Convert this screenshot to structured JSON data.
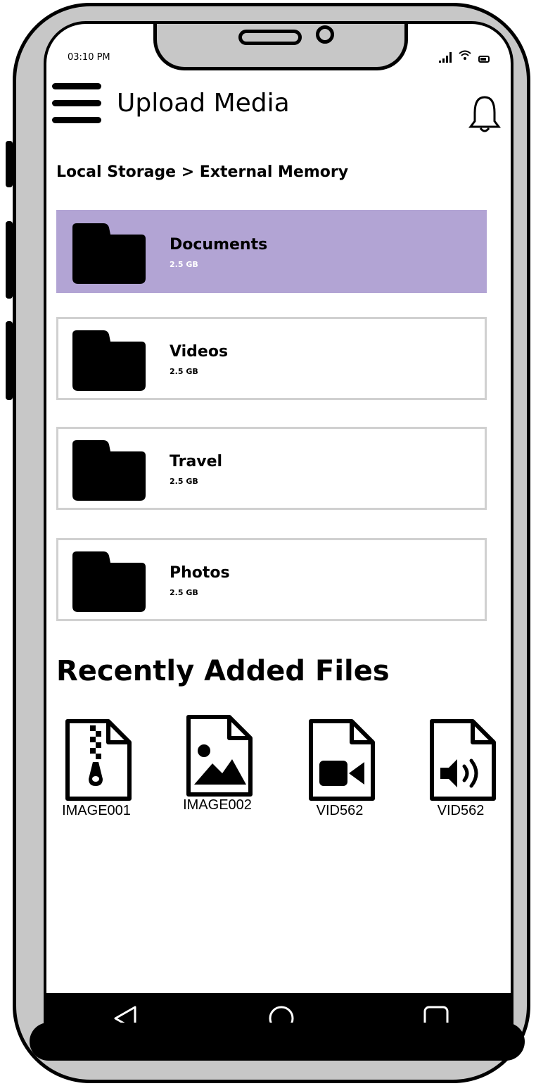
{
  "status_bar": {
    "time": "03:10 PM"
  },
  "header": {
    "title": "Upload Media"
  },
  "breadcrumb": "Local Storage > External Memory",
  "folders": [
    {
      "name": "Documents",
      "size": "2.5 GB",
      "selected": true
    },
    {
      "name": "Videos",
      "size": "2.5 GB",
      "selected": false
    },
    {
      "name": "Travel",
      "size": "2.5 GB",
      "selected": false
    },
    {
      "name": "Photos",
      "size": "2.5 GB",
      "selected": false
    }
  ],
  "recent": {
    "title": "Recently Added Files",
    "files": [
      {
        "label": "IMAGE001",
        "icon": "zip-file-icon"
      },
      {
        "label": "IMAGE002",
        "icon": "image-file-icon"
      },
      {
        "label": "VID562",
        "icon": "video-file-icon"
      },
      {
        "label": "VID562",
        "icon": "audio-file-icon"
      }
    ]
  },
  "colors": {
    "selected_folder": "#b2a4d4",
    "frame": "#c7c7c7"
  }
}
